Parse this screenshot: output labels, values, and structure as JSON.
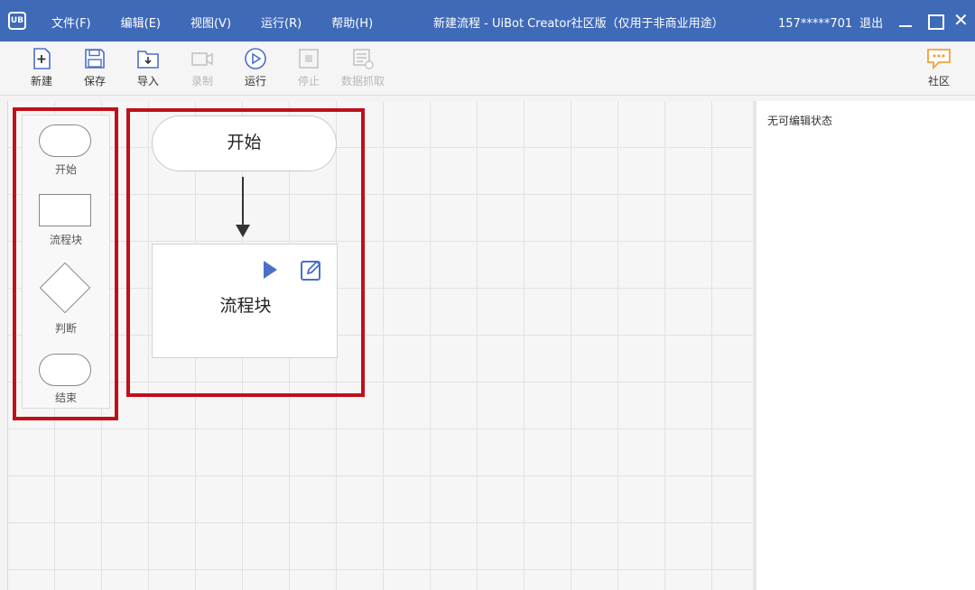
{
  "app": {
    "logo_text": "UB",
    "window_title": "新建流程 - UiBot Creator社区版（仅用于非商业用途）",
    "account_id": "157*****701",
    "logout_label": "退出",
    "close_glyph": "✕"
  },
  "menu": [
    {
      "label": "文件(F)"
    },
    {
      "label": "编辑(E)"
    },
    {
      "label": "视图(V)"
    },
    {
      "label": "运行(R)"
    },
    {
      "label": "帮助(H)"
    }
  ],
  "toolbar": {
    "new_label": "新建",
    "save_label": "保存",
    "import_label": "导入",
    "record_label": "录制",
    "run_label": "运行",
    "stop_label": "停止",
    "data_scrape_label": "数据抓取",
    "community_label": "社区"
  },
  "palette": {
    "items": [
      {
        "label": "开始",
        "icon": "rounded-rect-shape"
      },
      {
        "label": "流程块",
        "icon": "rectangle-shape"
      },
      {
        "label": "判断",
        "icon": "diamond-shape"
      },
      {
        "label": "结束",
        "icon": "rounded-rect-shape"
      }
    ]
  },
  "flow": {
    "start_node_label": "开始",
    "block_node_label": "流程块"
  },
  "properties": {
    "empty_text": "无可编辑状态"
  },
  "colors": {
    "titlebar": "#3f6ab8",
    "accent_blue": "#4a6fc7",
    "highlight_red": "#c0101a",
    "community_orange": "#f0a23a"
  }
}
